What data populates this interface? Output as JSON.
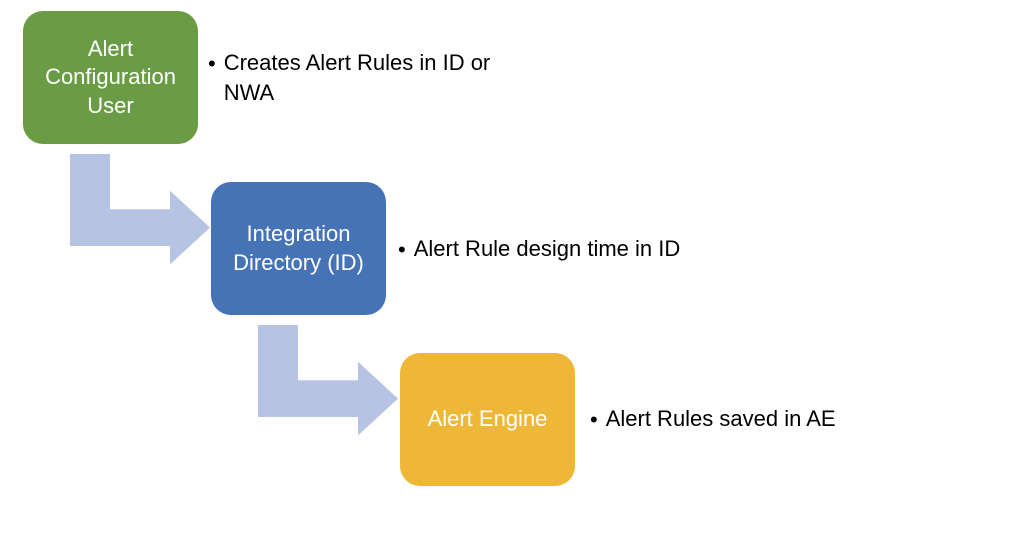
{
  "nodes": {
    "n1": {
      "label": "Alert Configuration User",
      "color": "#6a9c46"
    },
    "n2": {
      "label": "Integration Directory (ID)",
      "color": "#4573b5"
    },
    "n3": {
      "label": "Alert Engine",
      "color": "#eeb737"
    }
  },
  "bullets": {
    "b1": "Creates Alert Rules in ID or NWA",
    "b2": "Alert Rule design time in ID",
    "b3": "Alert Rules saved in AE"
  },
  "arrow_color": "#b6c3e2"
}
